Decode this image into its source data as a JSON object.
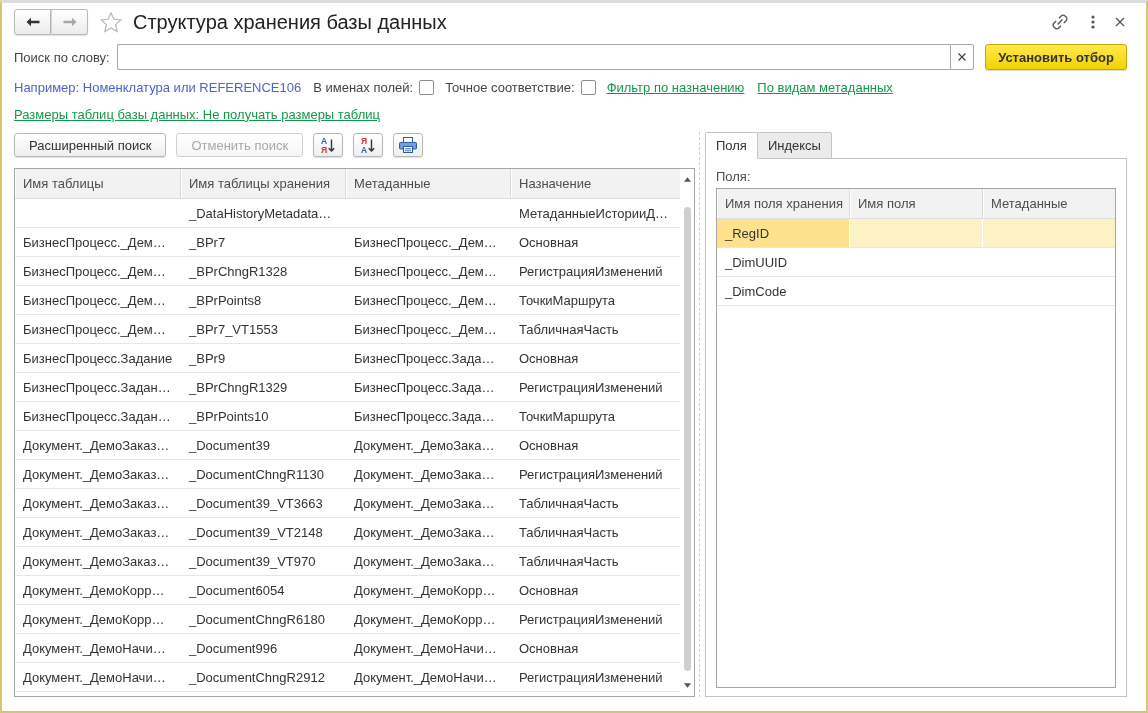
{
  "window": {
    "title": "Структура хранения базы данных",
    "favorite": false
  },
  "navigation": [
    {
      "kind": "back",
      "disabled": false
    },
    {
      "kind": "forward",
      "disabled": true
    }
  ],
  "search": {
    "label": "Поиск по слову:",
    "button": "Установить отбор"
  },
  "filters": {
    "example": "Например: Номенклатура или REFERENCE106",
    "options": [
      {
        "label": "В именах полей:",
        "checked": false
      },
      {
        "label": "Точное соответствие:",
        "checked": false
      }
    ],
    "links": [
      "Фильтр по назначению",
      "По видам метаданных"
    ],
    "sizes_link": "Размеры таблиц базы данных: Не получать размеры таблиц"
  },
  "toolbar": [
    {
      "kind": "button",
      "label": "Расширенный поиск",
      "disabled": false
    },
    {
      "kind": "button",
      "label": "Отменить поиск",
      "disabled": true
    },
    {
      "kind": "sort-ascending",
      "letters": [
        "А",
        "Я"
      ]
    },
    {
      "kind": "sort-descending",
      "letters": [
        "Я",
        "А"
      ]
    },
    {
      "kind": "print"
    }
  ],
  "tables": {
    "columns": [
      "Имя таблицы",
      "Имя таблицы хранения",
      "Метаданные",
      "Назначение"
    ],
    "rows": [
      {
        "storage_table_name": "_DataHistoryMetadata…",
        "purpose": "МетаданныеИсторииД…"
      },
      {
        "table_name": "БизнесПроцесс._Дем…",
        "storage_table_name": "_BPr7",
        "metadata": "БизнесПроцесс._Дем…",
        "purpose": "Основная"
      },
      {
        "table_name": "БизнесПроцесс._Дем…",
        "storage_table_name": "_BPrChngR1328",
        "metadata": "БизнесПроцесс._Дем…",
        "purpose": "РегистрацияИзменений"
      },
      {
        "table_name": "БизнесПроцесс._Дем…",
        "storage_table_name": "_BPrPoints8",
        "metadata": "БизнесПроцесс._Дем…",
        "purpose": "ТочкиМаршрута"
      },
      {
        "table_name": "БизнесПроцесс._Дем…",
        "storage_table_name": "_BPr7_VT1553",
        "metadata": "БизнесПроцесс._Дем…",
        "purpose": "ТабличнаяЧасть"
      },
      {
        "table_name": "БизнесПроцесс.Задание",
        "storage_table_name": "_BPr9",
        "metadata": "БизнесПроцесс.Зада…",
        "purpose": "Основная"
      },
      {
        "table_name": "БизнесПроцесс.Задан…",
        "storage_table_name": "_BPrChngR1329",
        "metadata": "БизнесПроцесс.Зада…",
        "purpose": "РегистрацияИзменений"
      },
      {
        "table_name": "БизнесПроцесс.Задан…",
        "storage_table_name": "_BPrPoints10",
        "metadata": "БизнесПроцесс.Зада…",
        "purpose": "ТочкиМаршрута"
      },
      {
        "table_name": "Документ._ДемоЗаказ…",
        "storage_table_name": "_Document39",
        "metadata": "Документ._ДемоЗака…",
        "purpose": "Основная"
      },
      {
        "table_name": "Документ._ДемоЗаказ…",
        "storage_table_name": "_DocumentChngR1130",
        "metadata": "Документ._ДемоЗака…",
        "purpose": "РегистрацияИзменений"
      },
      {
        "table_name": "Документ._ДемоЗаказ…",
        "storage_table_name": "_Document39_VT3663",
        "metadata": "Документ._ДемоЗака…",
        "purpose": "ТабличнаяЧасть"
      },
      {
        "table_name": "Документ._ДемоЗаказ…",
        "storage_table_name": "_Document39_VT2148",
        "metadata": "Документ._ДемоЗака…",
        "purpose": "ТабличнаяЧасть"
      },
      {
        "table_name": "Документ._ДемоЗаказ…",
        "storage_table_name": "_Document39_VT970",
        "metadata": "Документ._ДемоЗака…",
        "purpose": "ТабличнаяЧасть"
      },
      {
        "table_name": "Документ._ДемоКорр…",
        "storage_table_name": "_Document6054",
        "metadata": "Документ._ДемоКорр…",
        "purpose": "Основная"
      },
      {
        "table_name": "Документ._ДемоКорр…",
        "storage_table_name": "_DocumentChngR6180",
        "metadata": "Документ._ДемоКорр…",
        "purpose": "РегистрацияИзменений"
      },
      {
        "table_name": "Документ._ДемоНачи…",
        "storage_table_name": "_Document996",
        "metadata": "Документ._ДемоНачи…",
        "purpose": "Основная"
      },
      {
        "table_name": "Документ._ДемоНачи…",
        "storage_table_name": "_DocumentChngR2912",
        "metadata": "Документ._ДемоНачи…",
        "purpose": "РегистрацияИзменений"
      }
    ]
  },
  "details": {
    "tabs": [
      {
        "label": "Поля",
        "selected": true
      },
      {
        "label": "Индексы",
        "selected": false
      }
    ],
    "fields_label": "Поля:",
    "fields": {
      "columns": [
        "Имя поля хранения",
        "Имя поля",
        "Метаданные"
      ],
      "rows": [
        {
          "storage_field_name": "_RegID",
          "selected": true
        },
        {
          "storage_field_name": "_DimUUID",
          "selected": false
        },
        {
          "storage_field_name": "_DimCode",
          "selected": false
        }
      ]
    }
  }
}
